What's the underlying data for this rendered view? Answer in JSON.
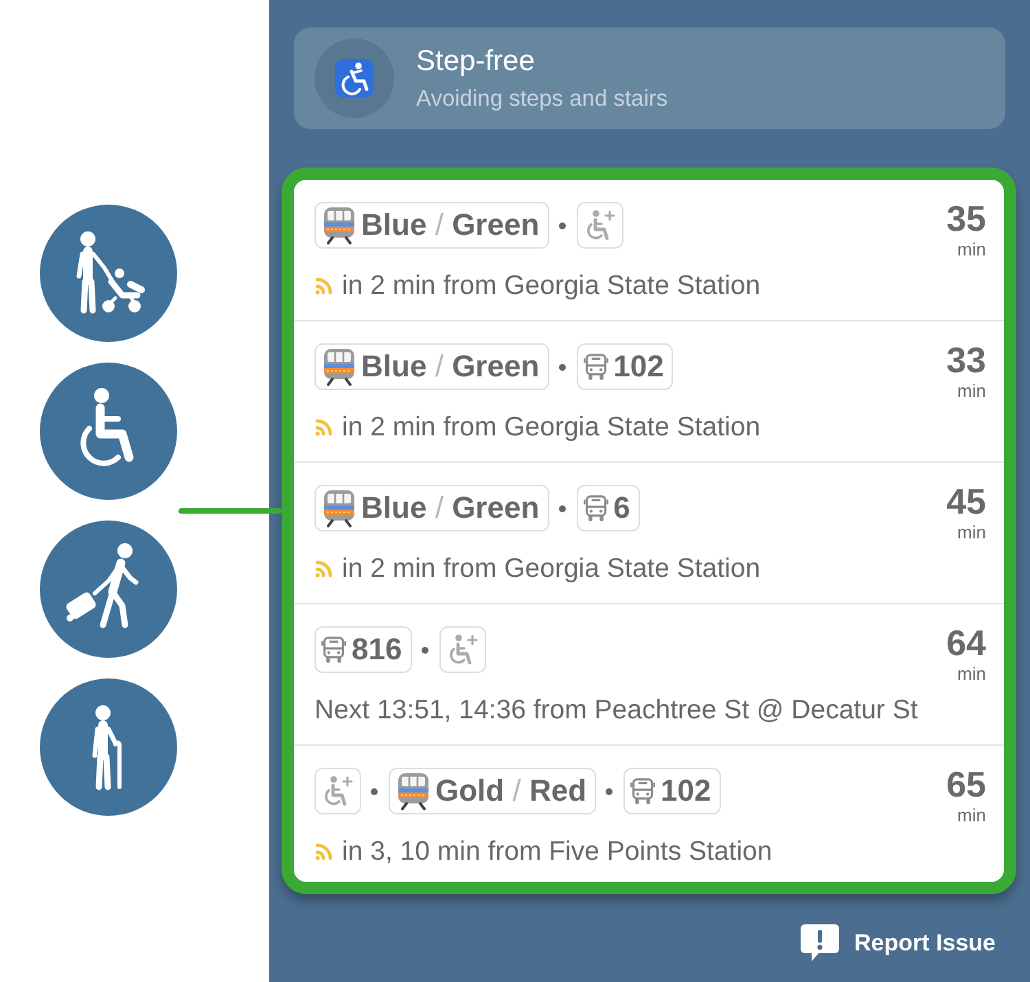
{
  "mode": {
    "title": "Step-free",
    "subtitle": "Avoiding steps and stairs"
  },
  "routes": [
    {
      "legs": [
        {
          "kind": "rail",
          "names": [
            "Blue",
            "Green"
          ],
          "separator": "/"
        },
        {
          "kind": "accessible"
        }
      ],
      "duration": "35",
      "unit": "min",
      "realtime": true,
      "departure": "in 2 min from Georgia State Station"
    },
    {
      "legs": [
        {
          "kind": "rail",
          "names": [
            "Blue",
            "Green"
          ],
          "separator": "/"
        },
        {
          "kind": "bus",
          "number": "102"
        }
      ],
      "duration": "33",
      "unit": "min",
      "realtime": true,
      "departure": "in 2 min from Georgia State Station"
    },
    {
      "legs": [
        {
          "kind": "rail",
          "names": [
            "Blue",
            "Green"
          ],
          "separator": "/"
        },
        {
          "kind": "bus",
          "number": "6"
        }
      ],
      "duration": "45",
      "unit": "min",
      "realtime": true,
      "departure": "in 2 min from Georgia State Station"
    },
    {
      "legs": [
        {
          "kind": "bus",
          "number": "816"
        },
        {
          "kind": "accessible"
        }
      ],
      "duration": "64",
      "unit": "min",
      "realtime": false,
      "departure": "Next 13:51, 14:36 from Peachtree St @ Decatur St"
    },
    {
      "legs": [
        {
          "kind": "accessible"
        },
        {
          "kind": "rail",
          "names": [
            "Gold",
            "Red"
          ],
          "separator": "/"
        },
        {
          "kind": "bus",
          "number": "102"
        }
      ],
      "duration": "65",
      "unit": "min",
      "realtime": true,
      "departure": "in 3, 10 min from Five Points Station"
    }
  ],
  "report_button": {
    "label": "Report Issue"
  }
}
